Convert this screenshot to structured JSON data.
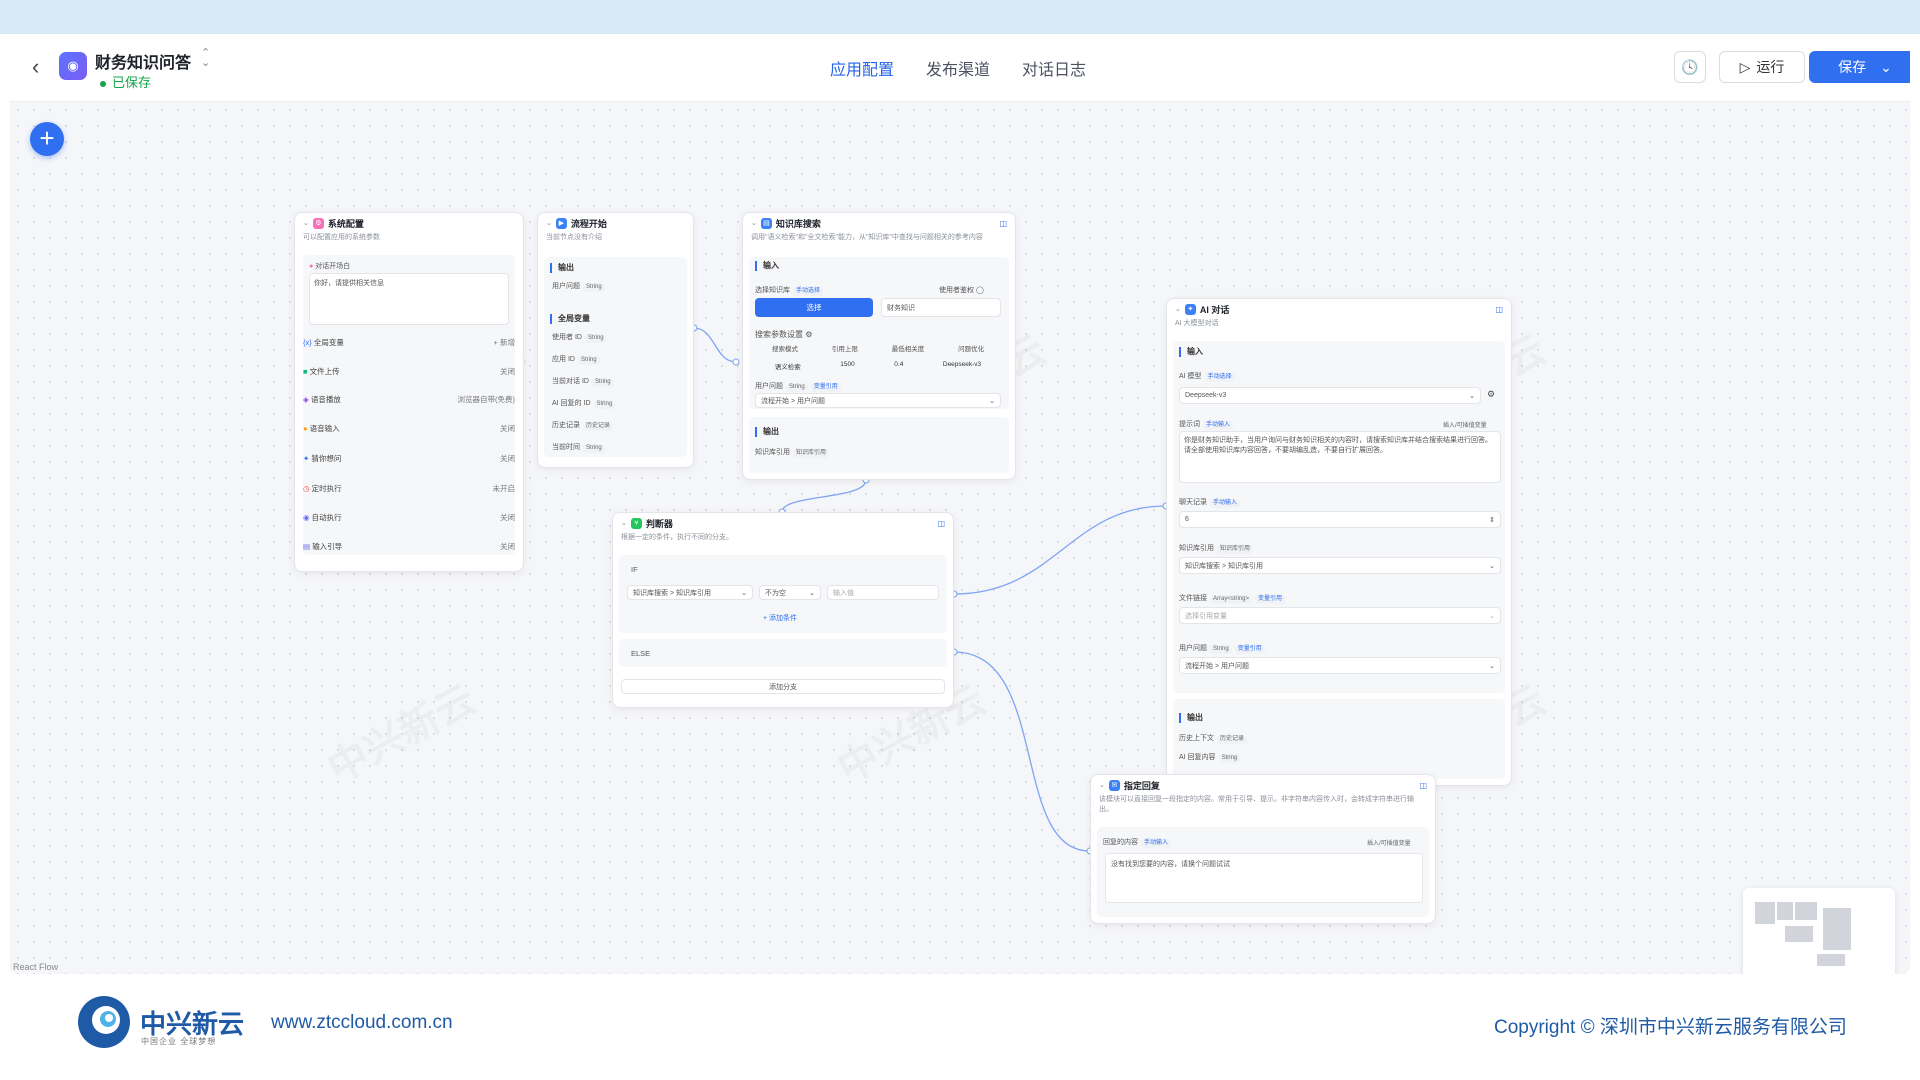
{
  "header": {
    "app_title": "财务知识问答",
    "save_status": "已保存",
    "tabs": [
      "应用配置",
      "发布渠道",
      "对话日志"
    ],
    "run_label": "运行",
    "save_label": "保存"
  },
  "nodes": {
    "system": {
      "title": "系统配置",
      "desc": "可以配置应用的系统参数",
      "opening_label": "对话开场白",
      "opening_text": "你好，请提供相关信息",
      "rows": [
        {
          "label": "全局变量",
          "value": "+ 新增"
        },
        {
          "label": "文件上传",
          "value": "关闭"
        },
        {
          "label": "语音播放",
          "value": "浏览器自带(免费)"
        },
        {
          "label": "语音输入",
          "value": "关闭"
        },
        {
          "label": "猜你想问",
          "value": "关闭"
        },
        {
          "label": "定时执行",
          "value": "未开启"
        },
        {
          "label": "自动执行",
          "value": "关闭"
        },
        {
          "label": "输入引导",
          "value": "关闭"
        }
      ]
    },
    "start": {
      "title": "流程开始",
      "desc": "当前节点没有介绍",
      "output_label": "输出",
      "output_item": "用户问题",
      "output_type": "String",
      "globals_label": "全局变量",
      "globals": [
        {
          "name": "使用者 ID",
          "type": "String"
        },
        {
          "name": "应用 ID",
          "type": "String"
        },
        {
          "name": "当前对话 ID",
          "type": "String"
        },
        {
          "name": "AI 回复的 ID",
          "type": "String"
        },
        {
          "name": "历史记录",
          "type": "历史记录"
        },
        {
          "name": "当前时间",
          "type": "String"
        }
      ]
    },
    "kb": {
      "title": "知识库搜索",
      "desc": "调用\"语义检索\"和\"全文检索\"能力，从\"知识库\"中查找与问题相关的参考内容",
      "input_label": "输入",
      "select_kb_label": "选择知识库",
      "manual": "手动选择",
      "permission": "使用者鉴权",
      "select_btn": "选择",
      "kb_name": "财务知识",
      "search_params": "搜索参数设置",
      "table_headers": [
        "搜索模式",
        "引用上限",
        "最低相关度",
        "问题优化"
      ],
      "table_row": [
        "语义检索",
        "1500",
        "0.4",
        "Deepseek-v3"
      ],
      "question_label": "用户问题",
      "question_type": "String",
      "var_ref": "变量引用",
      "question_value": "流程开始 > 用户问题",
      "output_label": "输出",
      "output_item": "知识库引用",
      "output_type": "知识库引用"
    },
    "judge": {
      "title": "判断器",
      "desc": "根据一定的条件，执行不同的分支。",
      "if_label": "IF",
      "cond_var": "知识库搜索 > 知识库引用",
      "cond_op": "不为空",
      "cond_placeholder": "输入值",
      "add_cond": "+ 添加条件",
      "else_label": "ELSE",
      "add_branch": "添加分支"
    },
    "ai": {
      "title": "AI 对话",
      "desc": "AI 大模型对话",
      "input_label": "输入",
      "model_label": "AI 模型",
      "manual_select": "手动选择",
      "model_value": "Deepseek-v3",
      "prompt_label": "提示词",
      "manual_input": "手动输入",
      "insert_hint": "插入/可插值变量",
      "prompt_text": "你是财务知识助手，当用户询问与财务知识相关的内容时，请搜索知识库并结合搜索结果进行回答。请全部使用知识库内容回答，不要胡编乱造，不要自行扩展回答。",
      "history_label": "聊天记录",
      "history_value": "6",
      "kb_ref_label": "知识库引用",
      "kb_ref_badge": "知识库引用",
      "kb_ref_value": "知识库搜索 > 知识库引用",
      "file_label": "文件链接",
      "file_type": "Array<string>",
      "var_ref": "变量引用",
      "file_placeholder": "选择引用变量",
      "question_label": "用户问题",
      "question_type": "String",
      "question_value": "流程开始 > 用户问题",
      "output_label": "输出",
      "outputs": [
        {
          "name": "历史上下文",
          "type": "历史记录"
        },
        {
          "name": "AI 回复内容",
          "type": "String"
        }
      ]
    },
    "reply": {
      "title": "指定回复",
      "desc": "该模块可以直接回复一段指定的内容。常用于引导、提示。非字符串内容传入时，会转成字符串进行输出。",
      "content_label": "回复的内容",
      "manual_input": "手动输入",
      "insert_hint": "插入/可插值变量",
      "content_text": "没有找到您要的内容，请换个问题试试"
    }
  },
  "canvas": {
    "react_flow_label": "React Flow"
  },
  "footer": {
    "company": "中兴新云",
    "slogan": "中国企业 全球梦想",
    "url": "www.ztccloud.com.cn",
    "copyright": "Copyright © 深圳市中兴新云服务有限公司"
  },
  "colors": {
    "accent": "#2f6ff0",
    "brand": "#1f5aa6",
    "saved": "#16a34a"
  }
}
